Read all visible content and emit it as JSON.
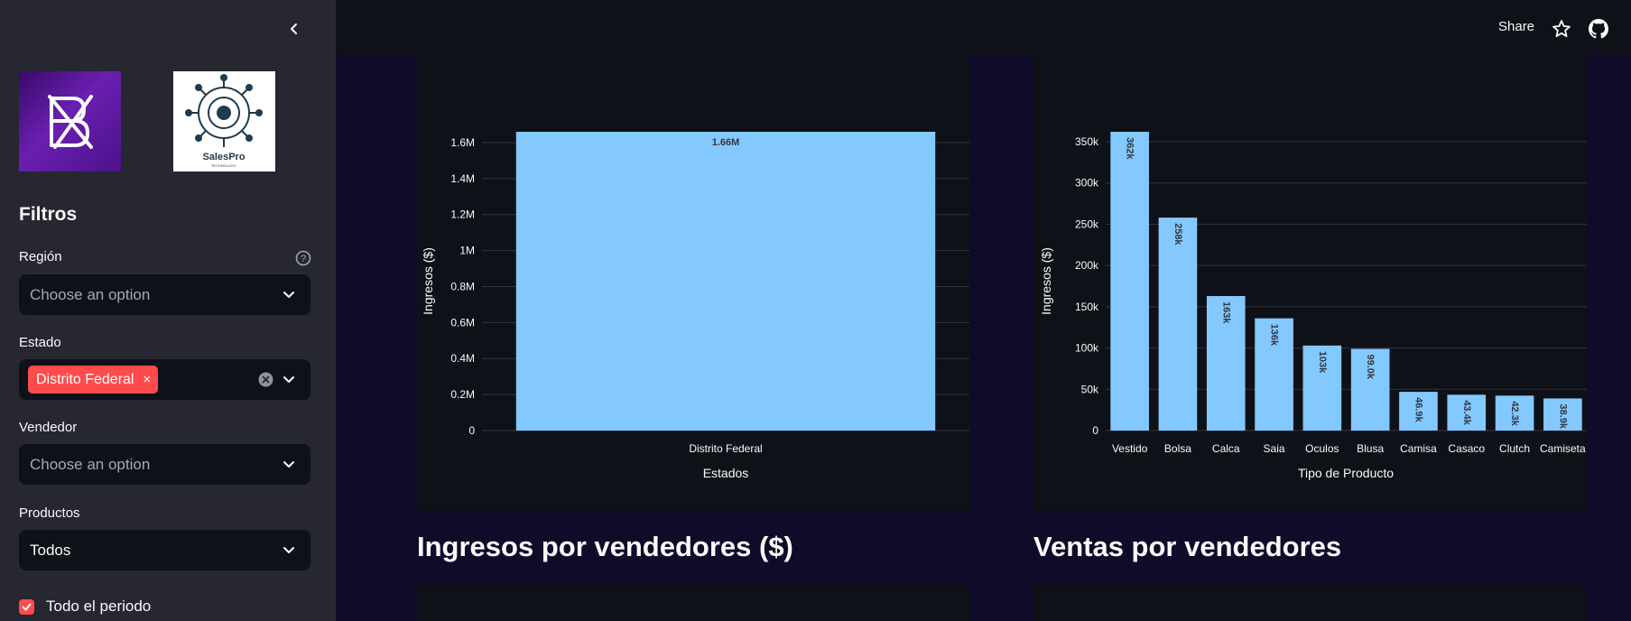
{
  "header": {
    "share_label": "Share",
    "icons": [
      "star-icon",
      "github-icon"
    ]
  },
  "sidebar": {
    "logos": [
      {
        "name": "company-logo",
        "text": ""
      },
      {
        "name": "salespro-logo",
        "text": "SalesPro",
        "subtext": "TECHNOLOGY"
      }
    ],
    "title": "Filtros",
    "filters": {
      "region": {
        "label": "Región",
        "placeholder": "Choose an option"
      },
      "estado": {
        "label": "Estado",
        "selected": [
          "Distrito Federal"
        ],
        "remove_symbol": "×"
      },
      "vendedor": {
        "label": "Vendedor",
        "placeholder": "Choose an option"
      },
      "productos": {
        "label": "Productos",
        "value": "Todos"
      }
    },
    "checkbox": {
      "label": "Todo el periodo",
      "checked": true
    }
  },
  "main": {
    "section_titles": [
      "Ingresos por vendedores ($)",
      "Ventas por vendedores"
    ]
  },
  "chart_data": [
    {
      "type": "bar",
      "categories": [
        "Distrito Federal"
      ],
      "values": [
        1660000
      ],
      "data_labels": [
        "1.66M"
      ],
      "xlabel": "Estados",
      "ylabel": "Ingresos ($)",
      "ylim": [
        0,
        1660000
      ],
      "yticks": [
        0,
        200000,
        400000,
        600000,
        800000,
        1000000,
        1200000,
        1400000,
        1600000
      ],
      "ytick_labels": [
        "0",
        "0.2M",
        "0.4M",
        "0.6M",
        "0.8M",
        "1M",
        "1.2M",
        "1.4M",
        "1.6M"
      ],
      "bar_color": "#83c9ff",
      "grid": true
    },
    {
      "type": "bar",
      "categories": [
        "Vestido",
        "Bolsa",
        "Calca",
        "Saia",
        "Oculos",
        "Blusa",
        "Camisa",
        "Casaco",
        "Clutch",
        "Camiseta"
      ],
      "values": [
        362000,
        258000,
        163000,
        136000,
        103000,
        99000,
        46900,
        43400,
        42300,
        38900
      ],
      "data_labels": [
        "362k",
        "258k",
        "163k",
        "136k",
        "103k",
        "99.0k",
        "46.9k",
        "43.4k",
        "42.3k",
        "38.9k"
      ],
      "xlabel": "Tipo de Producto",
      "ylabel": "Ingresos ($)",
      "ylim": [
        0,
        362000
      ],
      "yticks": [
        0,
        50000,
        100000,
        150000,
        200000,
        250000,
        300000,
        350000
      ],
      "ytick_labels": [
        "0",
        "50k",
        "100k",
        "150k",
        "200k",
        "250k",
        "300k",
        "350k"
      ],
      "bar_color": "#83c9ff",
      "grid": true
    }
  ]
}
